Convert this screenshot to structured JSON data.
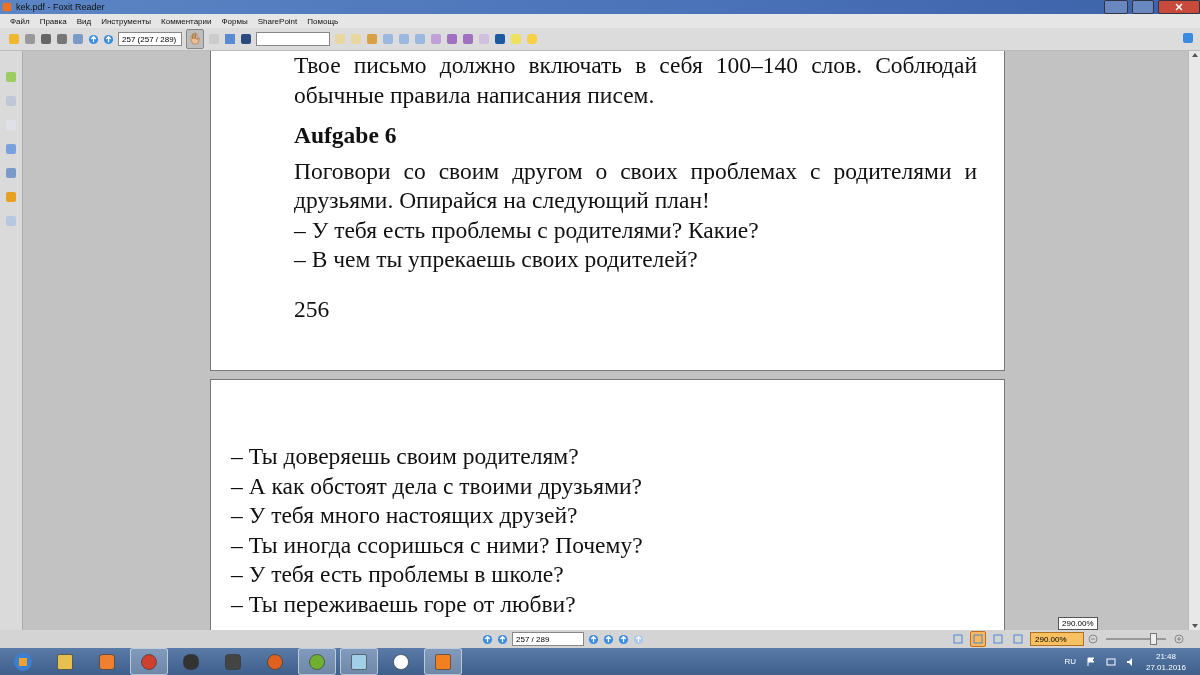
{
  "window": {
    "title": "kek.pdf - Foxit Reader"
  },
  "menu": [
    "Файл",
    "Правка",
    "Вид",
    "Инструменты",
    "Комментарии",
    "Формы",
    "SharePoint",
    "Помощь"
  ],
  "toolbar": {
    "page_field": "257 (257 / 289)",
    "hand_tool": {
      "selected": true
    }
  },
  "pages": [
    {
      "lines": [
        {
          "kind": "justified",
          "text": "Твое письмо должно включать в себя 100–140 слов. Соблюдай"
        },
        {
          "kind": "line",
          "text": "обычные правила написания писем."
        },
        {
          "kind": "heading",
          "text": "Aufgabe 6"
        },
        {
          "kind": "justified",
          "text": "Поговори со своим другом о своих проблемах с родителями и"
        },
        {
          "kind": "line",
          "text": "друзьями. Опирайся на следующий план!"
        },
        {
          "kind": "line",
          "text": "– У тебя есть проблемы с родителями? Какие?"
        },
        {
          "kind": "line",
          "text": "– В чем ты упрекаешь своих родителей?"
        },
        {
          "kind": "page-number",
          "text": "256"
        }
      ]
    },
    {
      "lines": [
        {
          "kind": "line",
          "text": "– Ты доверяешь своим родителям?"
        },
        {
          "kind": "line",
          "text": "– А как обстоят дела с твоими друзьями?"
        },
        {
          "kind": "line",
          "text": "– У тебя много настоящих друзей?"
        },
        {
          "kind": "line",
          "text": "– Ты иногда ссоришься с ними? Почему?"
        },
        {
          "kind": "line",
          "text": "– У тебя есть проблемы в школе?"
        },
        {
          "kind": "line",
          "text": "– Ты переживаешь горе от любви?"
        }
      ]
    }
  ],
  "status_bar": {
    "page_field": "257 / 289",
    "view_modes": [
      {
        "selected": false
      },
      {
        "selected": true
      },
      {
        "selected": false
      },
      {
        "selected": false
      }
    ],
    "zoom_field": "290.00%",
    "zoom_tooltip": "290.00%",
    "zoom_slider": {
      "level": 0.78
    }
  },
  "taskbar": {
    "apps": [
      {
        "open": false
      },
      {
        "open": false
      },
      {
        "open": true
      },
      {
        "open": false
      },
      {
        "open": false
      },
      {
        "open": false
      },
      {
        "open": true
      },
      {
        "open": true
      },
      {
        "open": false
      },
      {
        "open": true
      }
    ],
    "language": "RU",
    "time": "21:48",
    "date": "27.01.2016"
  }
}
